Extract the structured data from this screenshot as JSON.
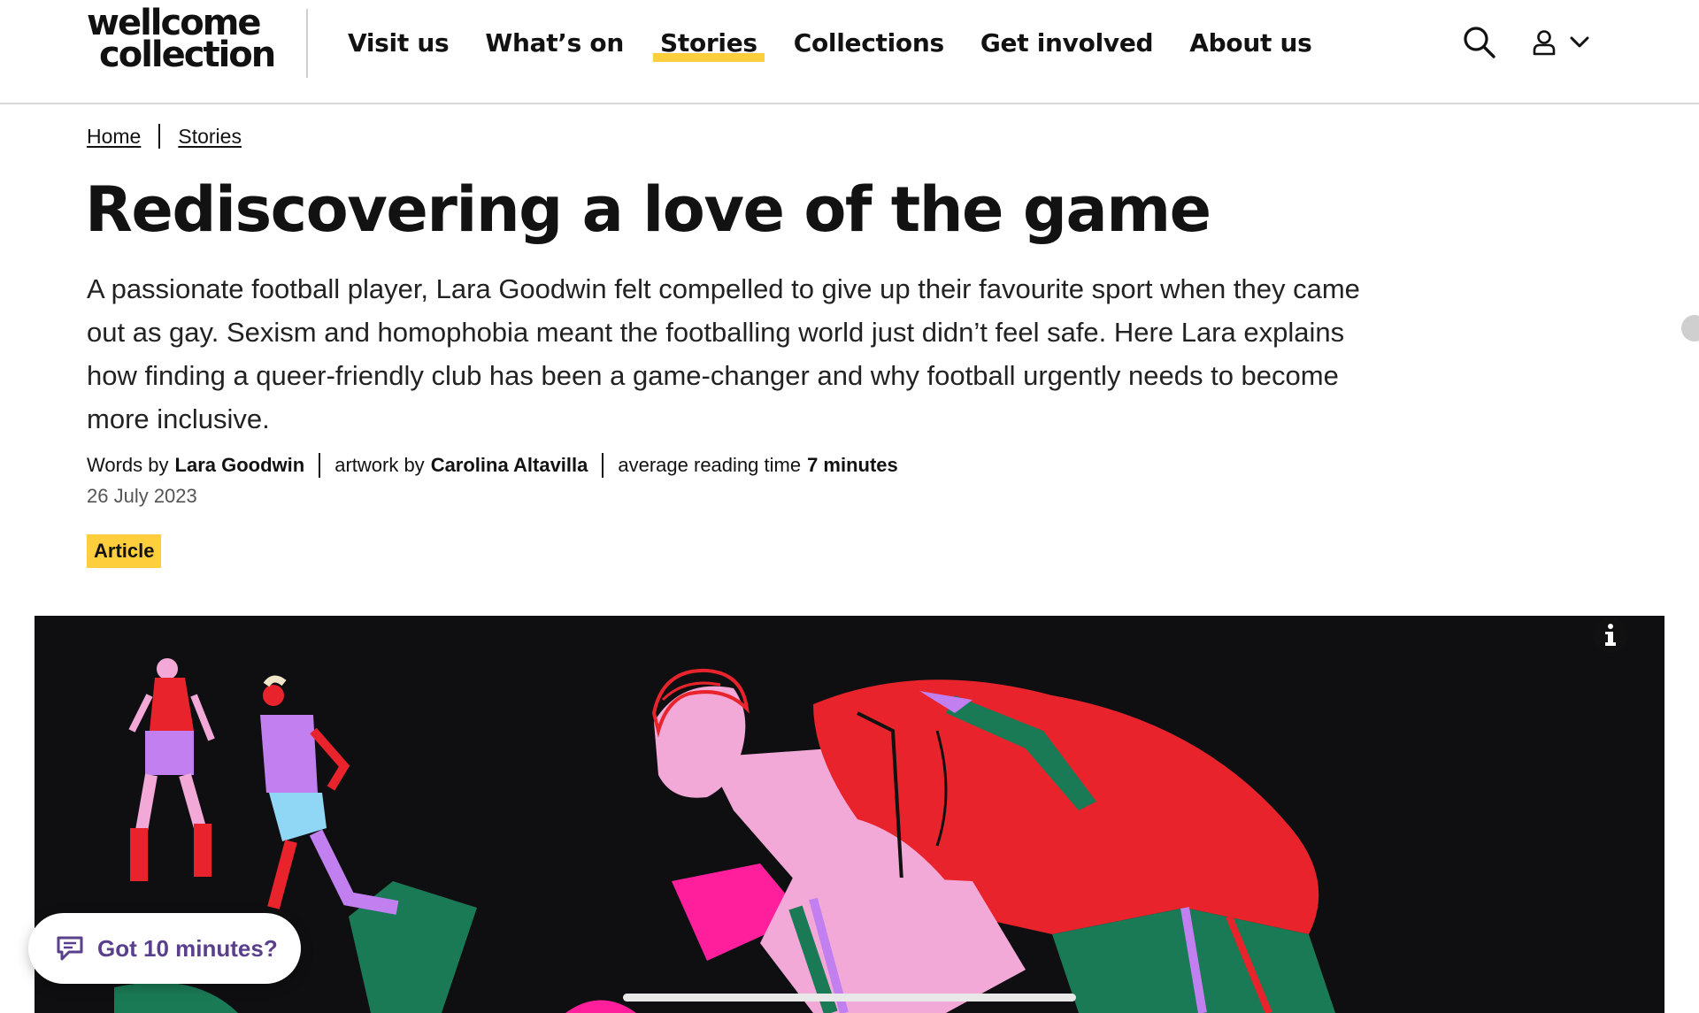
{
  "header": {
    "logo_line1": "wellcome",
    "logo_line2": "collection",
    "nav": [
      {
        "label": "Visit us"
      },
      {
        "label": "What’s on"
      },
      {
        "label": "Stories",
        "active": true
      },
      {
        "label": "Collections"
      },
      {
        "label": "Get involved"
      },
      {
        "label": "About us"
      }
    ],
    "search_icon": "search-icon",
    "user_icon": "user-icon"
  },
  "breadcrumb": [
    "Home",
    "Stories"
  ],
  "article": {
    "title": "Rediscovering a love of the game",
    "standfirst": "A passionate football player, Lara Goodwin felt compelled to give up their favourite sport when they came out as gay. Sexism and homophobia meant the footballing world just didn’t feel safe. Here Lara explains how finding a queer-friendly club has been a game-changer and why football urgently needs to become more inclusive.",
    "byline": {
      "words_prefix": "Words by",
      "words_author": "Lara Goodwin",
      "artwork_prefix": "artwork by",
      "artwork_author": "Carolina Altavilla",
      "reading_prefix": "average reading time",
      "reading_time": "7 minutes"
    },
    "date": "26 July 2023",
    "tag": "Article"
  },
  "hero": {
    "info_label": "i"
  },
  "floating": {
    "got10_label": "Got 10 minutes?"
  },
  "colors": {
    "accent_yellow": "#ffce3c",
    "hero_bg": "#0f0f12",
    "purple": "#5a3f8c"
  }
}
